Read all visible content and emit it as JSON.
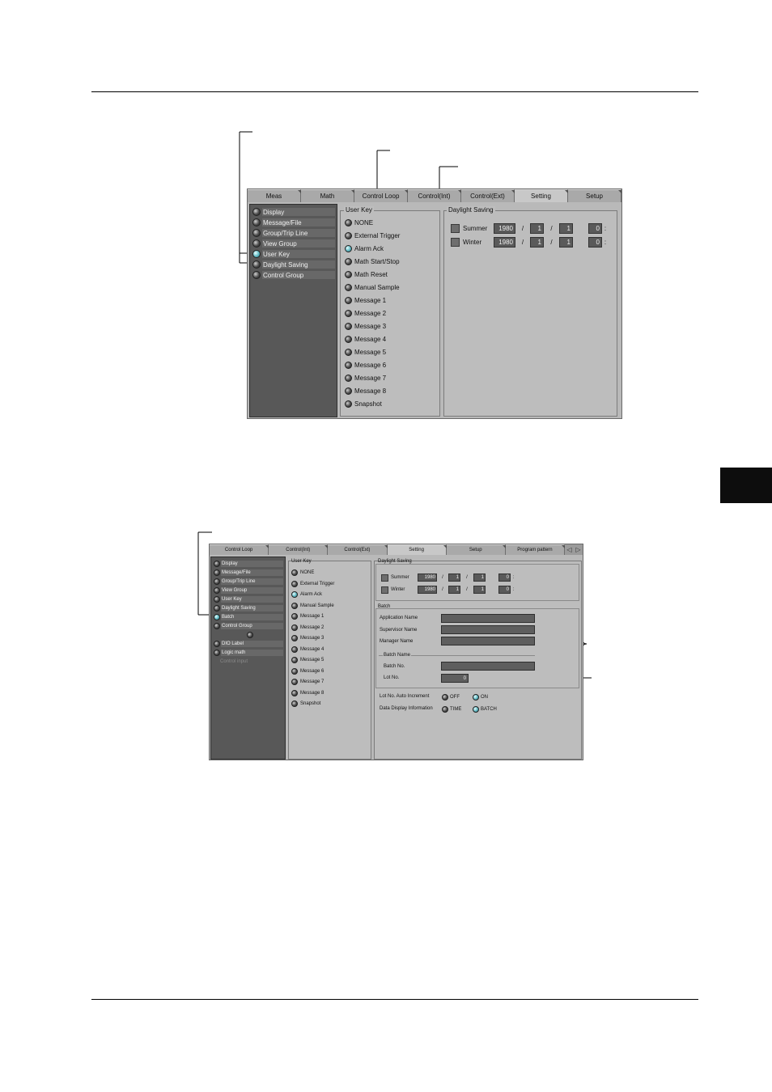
{
  "screen1": {
    "tabs": [
      "Meas",
      "Math",
      "Control Loop",
      "Control(Int)",
      "Control(Ext)",
      "Setting",
      "Setup"
    ],
    "active_tab_index": 5,
    "nav_items": [
      "Display",
      "Message/File",
      "Group/Trip Line",
      "View Group",
      "User Key",
      "Daylight Saving",
      "Control Group"
    ],
    "selected_nav_index": 4,
    "user_key": {
      "title": "User Key",
      "options": [
        "NONE",
        "External Trigger",
        "Alarm Ack",
        "Math Start/Stop",
        "Math Reset",
        "Manual Sample",
        "Message 1",
        "Message 2",
        "Message 3",
        "Message 4",
        "Message 5",
        "Message 6",
        "Message 7",
        "Message 8",
        "Snapshot"
      ],
      "selected_index": 2
    },
    "daylight_saving": {
      "title": "Daylight Saving",
      "rows": [
        {
          "label": "Summer",
          "year": "1980",
          "month": "1",
          "day": "1",
          "hour": "0"
        },
        {
          "label": "Winter",
          "year": "1980",
          "month": "1",
          "day": "1",
          "hour": "0"
        }
      ]
    }
  },
  "screen2": {
    "tabs": [
      "Control Loop",
      "Control(Int)",
      "Control(Ext)",
      "Setting",
      "Setup",
      "Program pattern"
    ],
    "active_tab_index": 3,
    "nav_items": [
      "Display",
      "Message/File",
      "Group/Trip Line",
      "View Group",
      "User Key",
      "Daylight Saving",
      "Batch",
      "Control Group",
      "DIO Label",
      "Logic math",
      "Control input"
    ],
    "selected_nav_index": 6,
    "user_key": {
      "title": "User Key",
      "options": [
        "NONE",
        "External Trigger",
        "Alarm Ack",
        "Manual Sample",
        "Message 1",
        "Message 2",
        "Message 3",
        "Message 4",
        "Message 5",
        "Message 6",
        "Message 7",
        "Message 8",
        "Snapshot"
      ],
      "selected_index": 2
    },
    "daylight_saving": {
      "title": "Daylight Saving",
      "rows": [
        {
          "label": "Summer",
          "year": "1980",
          "month": "1",
          "day": "1",
          "hour": "0"
        },
        {
          "label": "Winter",
          "year": "1980",
          "month": "1",
          "day": "1",
          "hour": "0"
        }
      ]
    },
    "batch": {
      "title": "Batch",
      "application_name_label": "Application Name",
      "supervisor_name_label": "Supervisor Name",
      "manager_name_label": "Manager Name",
      "batch_name_title": "Batch Name",
      "batch_no_label": "Batch No.",
      "lot_no_label": "Lot No.",
      "lot_no_value": "0",
      "auto_increment_label": "Lot No. Auto Increment",
      "auto_increment_options": [
        "OFF",
        "ON"
      ],
      "auto_increment_selected": 1,
      "display_info_label": "Data Display Information",
      "display_info_options": [
        "TIME",
        "BATCH"
      ],
      "display_info_selected": 1
    }
  }
}
